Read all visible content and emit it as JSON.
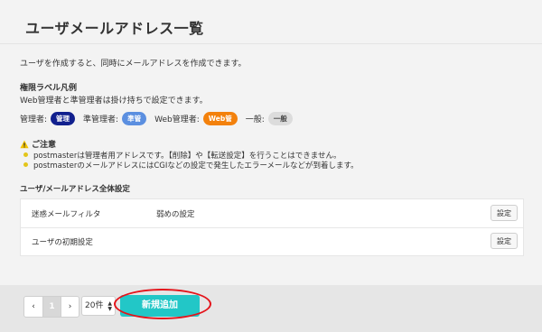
{
  "page": {
    "title": "ユーザメールアドレス一覧",
    "intro": "ユーザを作成すると、同時にメールアドレスを作成できます。"
  },
  "legend": {
    "title": "権限ラベル凡例",
    "desc": "Web管理者と準管理者は掛け持ちで設定できます。",
    "items": [
      {
        "label": "管理者:",
        "badge": "管理",
        "color": "#11208e"
      },
      {
        "label": "準管理者:",
        "badge": "準管",
        "color": "#5b8fe0"
      },
      {
        "label": "Web管理者:",
        "badge": "Web管",
        "color": "#f3810c"
      },
      {
        "label": "一般:",
        "badge": "一般",
        "color": "#dcdcdc"
      }
    ]
  },
  "notice": {
    "title": "ご注意",
    "icon": "warning-icon",
    "items": [
      "postmasterは管理者用アドレスです。【削除】や【転送設定】を行うことはできません。",
      "postmasterのメールアドレスにはCGIなどの設定で発生したエラーメールなどが到着します。"
    ]
  },
  "settings": {
    "title": "ユーザ/メールアドレス全体設定",
    "rows": [
      {
        "label": "迷惑メールフィルタ",
        "value": "弱めの設定",
        "button": "設定"
      },
      {
        "label": "ユーザの初期設定",
        "value": "",
        "button": "設定"
      }
    ]
  },
  "footer": {
    "pager": {
      "prev": "‹",
      "current": "1",
      "next": "›"
    },
    "per_page": "20件",
    "add_button": "新規追加"
  },
  "colors": {
    "accent": "#22c7c7",
    "highlight": "#e4141b"
  }
}
